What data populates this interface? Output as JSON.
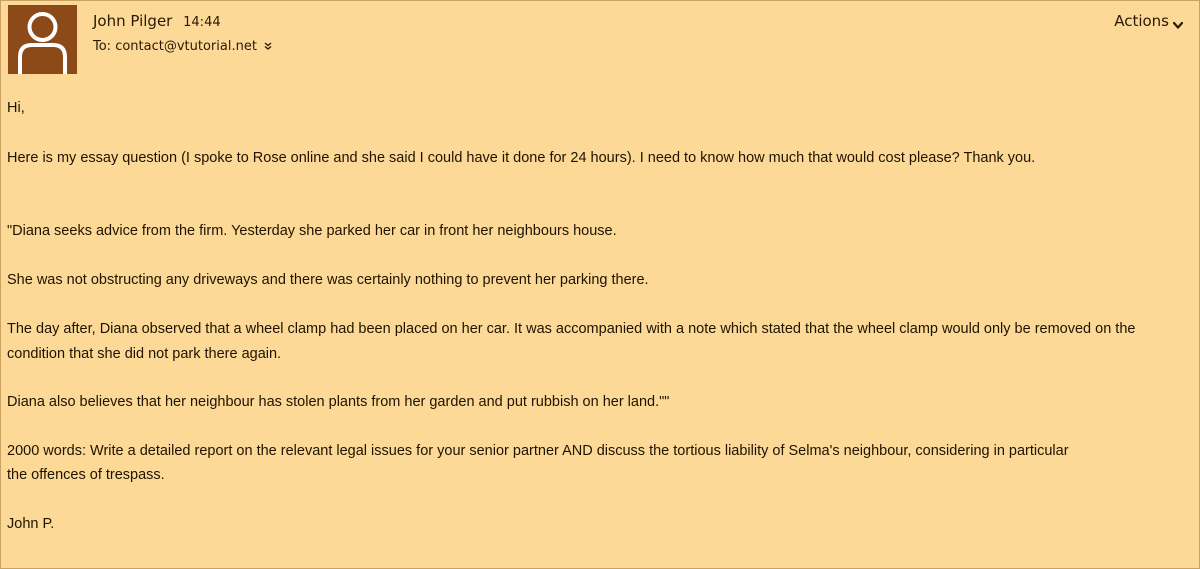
{
  "header": {
    "sender_name": "John Pilger",
    "time": "14:44",
    "to_label": "To: contact@vtutorial.net",
    "expand_icon": "double-chevron-down-icon",
    "actions_label": "Actions",
    "actions_icon": "chevron-down-icon",
    "avatar_icon": "user-silhouette-icon"
  },
  "message": {
    "greeting": "Hi,",
    "intro": "Here is my essay question (I spoke to Rose online and she said I could have it done for 24 hours). I need to know how much that would cost please? Thank you.",
    "p1": "\"Diana seeks advice from the firm. Yesterday she parked her car in front her neighbours house.",
    "p2": "She was not obstructing any driveways and there was certainly nothing to prevent her parking there.",
    "p3": "The day after, Diana observed that a wheel clamp had been placed on her car. It was accompanied with a note which stated that the wheel clamp would only be removed on the condition that she did not park there again.",
    "p4": "Diana also believes that her neighbour has stolen plants from her garden and put rubbish on her land.\"\"",
    "task_line1": "2000 words: Write a detailed report on the relevant legal issues for your senior partner AND discuss the tortious liability of Selma's neighbour, considering in particular",
    "task_line2": "the offences of trespass.",
    "signoff": "John P."
  },
  "colors": {
    "background": "#fcd997",
    "avatar_bg": "#8c4a19",
    "avatar_fg": "#ffffff",
    "text": "#1f1400"
  }
}
